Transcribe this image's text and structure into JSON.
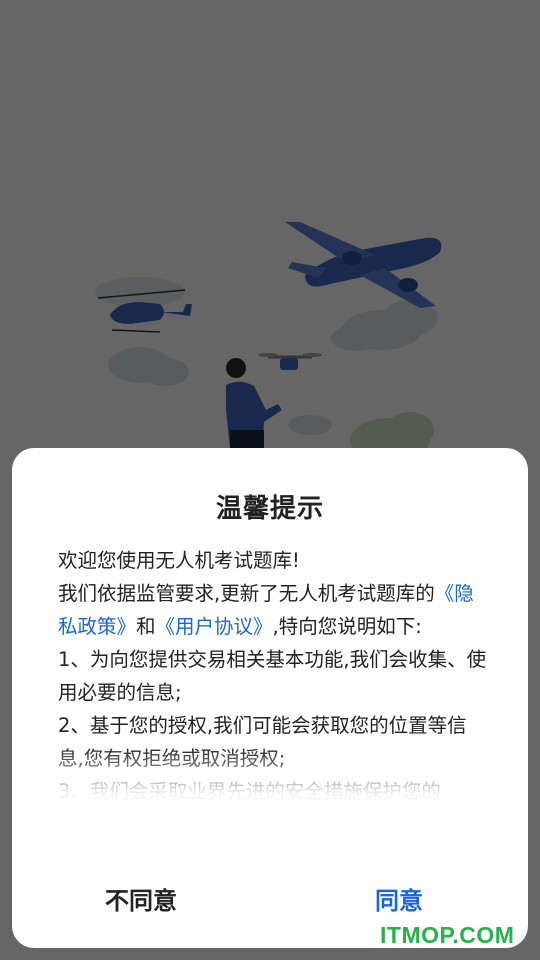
{
  "dialog": {
    "title": "温馨提示",
    "line1": "欢迎您使用无人机考试题库!",
    "line2": "我们依据监管要求,更新了无人机考试题库的",
    "privacy_link": "《隐私政策》",
    "and": "和",
    "agreement_link": "《用户协议》",
    "line3_tail": ",特向您说明如",
    "line4": "下:",
    "item1": "1、为向您提供交易相关基本功能,我们会收集、使用必要的信息;",
    "item2": "2、基于您的授权,我们可能会获取您的位置等信息,您有权拒绝或取消授权;",
    "item3": "3、我们会采取业界先进的安全措施保护您的",
    "disagree_label": "不同意",
    "agree_label": "同意"
  },
  "watermark": "ITMOP.COM",
  "colors": {
    "link": "#1a66d9",
    "watermark": "#26b34a",
    "overlay": "rgba(0,0,0,0.60)"
  },
  "icons": [
    "airplane-illustration",
    "helicopter-illustration",
    "drone-illustration",
    "person-illustration"
  ]
}
